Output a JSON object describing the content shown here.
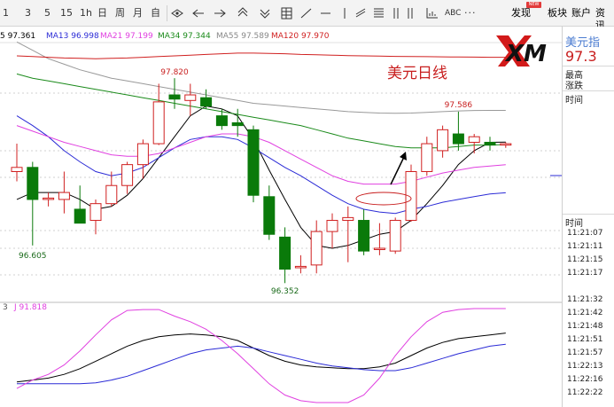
{
  "toolbar": {
    "items": [
      "1",
      "3",
      "5",
      "15",
      "1h",
      "日",
      "周",
      "月",
      "自"
    ],
    "icons": [
      "eye-icon",
      "arrow-left-icon",
      "arrow-right-icon",
      "zoom-in-icon",
      "zoom-out-icon",
      "grid-icon",
      "line-tool-icon",
      "hline-icon",
      "vline-icon",
      "channel-icon",
      "fib-icon",
      "bar-icon",
      "bar-icon",
      "chart-icon"
    ],
    "abc_label": "ABC",
    "more_label": "···",
    "right_tabs": [
      "发现",
      "板块",
      "账户",
      "资讯"
    ],
    "new_badge": "NEW"
  },
  "ma_legend": [
    {
      "label": "5 97.361",
      "color": "#000000"
    },
    {
      "label": "MA13 96.998",
      "color": "#2b2bd6"
    },
    {
      "label": "MA21 97.199",
      "color": "#e040e0"
    },
    {
      "label": "MA34 97.344",
      "color": "#1a8a1a"
    },
    {
      "label": "MA55 97.589",
      "color": "#888888"
    },
    {
      "label": "MA120 97.970",
      "color": "#d02020"
    }
  ],
  "logo_text": "XM",
  "chart_title": "美元日线",
  "kdj_legend": "J 91.818",
  "kdj_prefix": "3",
  "chart_data": {
    "type": "candlestick",
    "candles": [
      {
        "o": 97.15,
        "h": 97.35,
        "l": 97.08,
        "c": 97.18
      },
      {
        "o": 97.18,
        "h": 97.22,
        "l": 96.62,
        "c": 96.95
      },
      {
        "o": 96.95,
        "h": 97.0,
        "l": 96.9,
        "c": 96.96
      },
      {
        "o": 96.95,
        "h": 97.15,
        "l": 96.85,
        "c": 97.0
      },
      {
        "o": 96.88,
        "h": 97.05,
        "l": 96.78,
        "c": 96.78
      },
      {
        "o": 96.8,
        "h": 96.95,
        "l": 96.7,
        "c": 96.92
      },
      {
        "o": 96.92,
        "h": 97.15,
        "l": 96.9,
        "c": 97.05
      },
      {
        "o": 97.05,
        "h": 97.22,
        "l": 96.99,
        "c": 97.2
      },
      {
        "o": 97.2,
        "h": 97.38,
        "l": 97.1,
        "c": 97.35
      },
      {
        "o": 97.35,
        "h": 97.78,
        "l": 97.34,
        "c": 97.65
      },
      {
        "o": 97.7,
        "h": 97.82,
        "l": 97.6,
        "c": 97.67
      },
      {
        "o": 97.66,
        "h": 97.78,
        "l": 97.55,
        "c": 97.7
      },
      {
        "o": 97.68,
        "h": 97.74,
        "l": 97.6,
        "c": 97.62
      },
      {
        "o": 97.55,
        "h": 97.6,
        "l": 97.45,
        "c": 97.48
      },
      {
        "o": 97.5,
        "h": 97.6,
        "l": 97.4,
        "c": 97.48
      },
      {
        "o": 97.45,
        "h": 97.48,
        "l": 96.93,
        "c": 96.98
      },
      {
        "o": 96.97,
        "h": 97.05,
        "l": 96.66,
        "c": 96.7
      },
      {
        "o": 96.68,
        "h": 96.75,
        "l": 96.35,
        "c": 96.45
      },
      {
        "o": 96.46,
        "h": 96.55,
        "l": 96.42,
        "c": 96.47
      },
      {
        "o": 96.48,
        "h": 96.8,
        "l": 96.42,
        "c": 96.72
      },
      {
        "o": 96.72,
        "h": 96.85,
        "l": 96.6,
        "c": 96.8
      },
      {
        "o": 96.8,
        "h": 96.9,
        "l": 96.5,
        "c": 96.82
      },
      {
        "o": 96.8,
        "h": 96.88,
        "l": 96.55,
        "c": 96.58
      },
      {
        "o": 96.6,
        "h": 96.78,
        "l": 96.55,
        "c": 96.6
      },
      {
        "o": 96.58,
        "h": 96.82,
        "l": 96.56,
        "c": 96.8
      },
      {
        "o": 96.8,
        "h": 97.2,
        "l": 96.79,
        "c": 97.15
      },
      {
        "o": 97.15,
        "h": 97.4,
        "l": 97.12,
        "c": 97.35
      },
      {
        "o": 97.3,
        "h": 97.48,
        "l": 97.25,
        "c": 97.45
      },
      {
        "o": 97.42,
        "h": 97.58,
        "l": 97.3,
        "c": 97.35
      },
      {
        "o": 97.36,
        "h": 97.42,
        "l": 97.28,
        "c": 97.4
      },
      {
        "o": 97.36,
        "h": 97.4,
        "l": 97.3,
        "c": 97.34
      },
      {
        "o": 97.34,
        "h": 97.36,
        "l": 97.32,
        "c": 97.35
      }
    ],
    "labels": [
      {
        "text": "97.820",
        "candle": 10,
        "value": 97.82,
        "pos": "above"
      },
      {
        "text": "97.586",
        "candle": 28,
        "value": 97.586,
        "pos": "above"
      },
      {
        "text": "96.605",
        "candle": 1,
        "value": 96.605,
        "pos": "below"
      },
      {
        "text": "96.352",
        "candle": 17,
        "value": 96.352,
        "pos": "below"
      }
    ],
    "ma": {
      "ma5": [
        96.95,
        97.0,
        97.0,
        97.0,
        96.95,
        96.88,
        96.9,
        96.98,
        97.1,
        97.25,
        97.4,
        97.55,
        97.62,
        97.6,
        97.55,
        97.38,
        97.16,
        96.95,
        96.75,
        96.62,
        96.6,
        96.62,
        96.66,
        96.7,
        96.72,
        96.8,
        96.92,
        97.05,
        97.2,
        97.3,
        97.36,
        97.361
      ],
      "ma13": [
        97.55,
        97.48,
        97.4,
        97.3,
        97.22,
        97.15,
        97.12,
        97.14,
        97.18,
        97.25,
        97.32,
        97.38,
        97.4,
        97.4,
        97.38,
        97.32,
        97.25,
        97.18,
        97.12,
        97.05,
        96.98,
        96.92,
        96.88,
        96.86,
        96.85,
        96.88,
        96.9,
        96.93,
        96.95,
        96.97,
        96.99,
        96.998
      ],
      "ma21": [
        97.48,
        97.44,
        97.4,
        97.36,
        97.33,
        97.3,
        97.27,
        97.26,
        97.26,
        97.28,
        97.32,
        97.36,
        97.4,
        97.42,
        97.42,
        97.4,
        97.36,
        97.3,
        97.24,
        97.18,
        97.12,
        97.08,
        97.06,
        97.06,
        97.06,
        97.08,
        97.11,
        97.14,
        97.16,
        97.18,
        97.19,
        97.199
      ],
      "ma34": [
        97.85,
        97.82,
        97.8,
        97.78,
        97.76,
        97.74,
        97.72,
        97.7,
        97.68,
        97.66,
        97.64,
        97.62,
        97.6,
        97.58,
        97.56,
        97.54,
        97.52,
        97.5,
        97.48,
        97.45,
        97.42,
        97.39,
        97.37,
        97.35,
        97.33,
        97.32,
        97.32,
        97.32,
        97.33,
        97.34,
        97.34,
        97.344
      ],
      "ma55": [
        98.08,
        98.02,
        97.96,
        97.92,
        97.88,
        97.85,
        97.82,
        97.8,
        97.78,
        97.76,
        97.74,
        97.72,
        97.7,
        97.68,
        97.66,
        97.64,
        97.63,
        97.62,
        97.61,
        97.6,
        97.59,
        97.58,
        97.575,
        97.57,
        97.568,
        97.57,
        97.575,
        97.58,
        97.585,
        97.588,
        97.589,
        97.589
      ],
      "ma120": [
        97.98,
        97.975,
        97.97,
        97.965,
        97.962,
        97.96,
        97.962,
        97.965,
        97.97,
        97.975,
        97.98,
        97.985,
        97.99,
        97.995,
        98.0,
        98.0,
        97.998,
        97.995,
        97.99,
        97.988,
        97.985,
        97.982,
        97.98,
        97.978,
        97.976,
        97.975,
        97.974,
        97.973,
        97.972,
        97.971,
        97.97,
        97.97
      ]
    },
    "kdj": {
      "k": [
        22,
        24,
        26,
        30,
        36,
        44,
        52,
        60,
        66,
        70,
        72,
        73,
        72,
        70,
        66,
        58,
        50,
        44,
        40,
        38,
        37,
        36,
        36,
        38,
        42,
        50,
        58,
        64,
        68,
        70,
        72,
        74
      ],
      "d": [
        20,
        20,
        20,
        20,
        20,
        21,
        24,
        28,
        34,
        40,
        46,
        52,
        56,
        58,
        60,
        58,
        54,
        50,
        46,
        42,
        39,
        37,
        35,
        34,
        34,
        37,
        42,
        47,
        52,
        56,
        60,
        62
      ],
      "j": [
        15,
        24,
        30,
        40,
        55,
        72,
        88,
        98,
        99,
        99,
        92,
        86,
        78,
        66,
        52,
        36,
        20,
        8,
        2,
        0,
        0,
        0,
        8,
        26,
        50,
        70,
        86,
        96,
        99,
        100,
        101,
        102
      ],
      "ylim": [
        0,
        100
      ]
    },
    "price_ylim": [
      96.25,
      98.05
    ],
    "current_price_label": "97.3"
  },
  "right_panel": {
    "title": "美元指",
    "price": "97.3",
    "rows": [
      "最高",
      "涨跌"
    ],
    "time_header_1": "时间",
    "time_header_2": "时间",
    "times": [
      "11:21:07",
      "11:21:11",
      "11:21:15",
      "11:21:17",
      "11:21:32",
      "11:21:42",
      "11:21:48",
      "11:21:51",
      "11:21:57",
      "11:22:13",
      "11:22:16",
      "11:22:22"
    ]
  }
}
